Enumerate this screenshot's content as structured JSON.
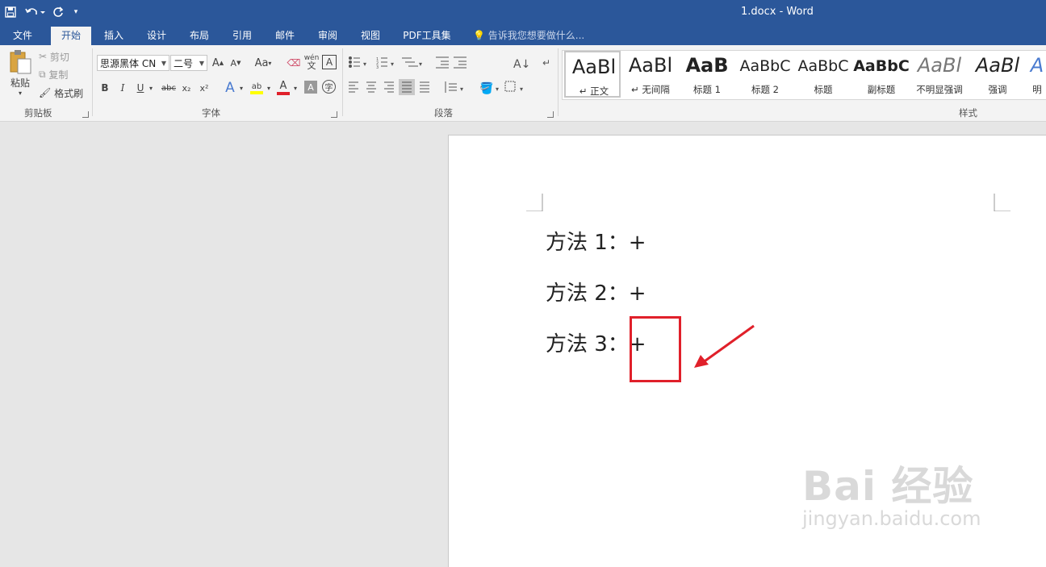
{
  "titlebar": {
    "doc_title": "1.docx - Word",
    "qat": [
      {
        "icon": "save-icon",
        "glyph": "💾"
      },
      {
        "icon": "undo-icon",
        "glyph": "↶ ▾"
      },
      {
        "icon": "redo-icon",
        "glyph": "↻"
      },
      {
        "icon": "customize-icon",
        "glyph": "▾"
      }
    ]
  },
  "tabs": [
    "文件",
    "开始",
    "插入",
    "设计",
    "布局",
    "引用",
    "邮件",
    "审阅",
    "视图",
    "PDF工具集"
  ],
  "tell_me": "告诉我您想要做什么...",
  "clipboard": {
    "paste": "粘贴",
    "cut": "剪切",
    "copy": "复制",
    "format_painter": "格式刷",
    "label": "剪贴板"
  },
  "font": {
    "family": "思源黑体 CN",
    "size": "二号",
    "label": "字体",
    "grow": "A",
    "shrink": "A",
    "case": "Aa",
    "bold": "B",
    "italic": "I",
    "underline": "U",
    "strike": "abc",
    "sub": "x₂",
    "sup": "x²",
    "wen": "wén",
    "A_box": "A",
    "char_circle": "字"
  },
  "paragraph": {
    "label": "段落"
  },
  "styles": {
    "label": "样式",
    "items": [
      {
        "preview": "AaBl",
        "name": "↵ 正文"
      },
      {
        "preview": "AaBl",
        "name": "↵ 无间隔"
      },
      {
        "preview": "AaB",
        "name": "标题 1"
      },
      {
        "preview": "AaBbC",
        "name": "标题 2"
      },
      {
        "preview": "AaBbC",
        "name": "标题"
      },
      {
        "preview": "AaBbC",
        "name": "副标题"
      },
      {
        "preview": "AaBl",
        "name": "不明显强调"
      },
      {
        "preview": "AaBl",
        "name": "强调"
      },
      {
        "preview": "A",
        "name": "明"
      }
    ]
  },
  "document": {
    "lines": [
      "方法 1：+",
      "方法 2：+",
      "方法 3：+"
    ]
  },
  "watermark": {
    "brand": "Bai 经验",
    "url": "jingyan.baidu.com"
  },
  "colors": {
    "ribbon_blue": "#2b579a",
    "highlight_red": "#e0202a"
  }
}
